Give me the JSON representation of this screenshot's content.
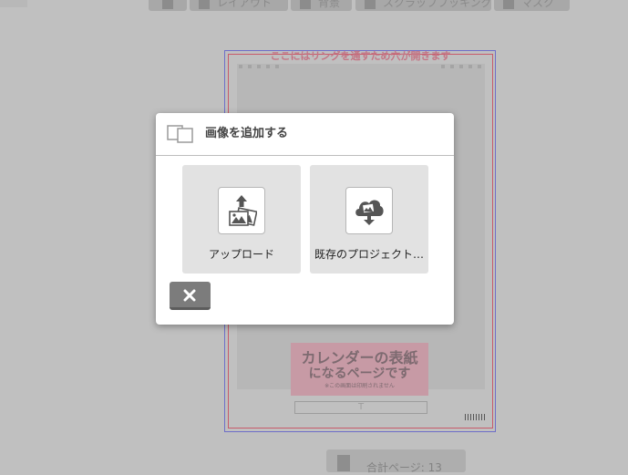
{
  "toolbar": {
    "items": [
      {
        "label": "",
        "icon": "pause-icon"
      },
      {
        "label": "レイアウト",
        "icon": "layout-icon"
      },
      {
        "label": "背景",
        "icon": "background-icon"
      },
      {
        "label": "スクラップブッキング",
        "icon": "scrapbook-icon"
      },
      {
        "label": "マスク",
        "icon": "mask-icon"
      }
    ]
  },
  "page": {
    "ring_notice": "ここにはリングを通すため穴が開きます",
    "cover_line1": "カレンダーの表紙",
    "cover_line2": "になるページです",
    "cover_note": "※この画面は印刷されません",
    "text_placeholder": "T"
  },
  "page_count": {
    "label": "合計ページ:",
    "value": "13"
  },
  "modal": {
    "title": "画像を追加する",
    "upload_label": "アップロード",
    "existing_label": "既存のプロジェクト…",
    "icons": {
      "header": "photos-icon",
      "upload": "upload-photo-icon",
      "existing": "cloud-download-icon",
      "close": "close-icon"
    }
  },
  "colors": {
    "overlay": "#c0c0c0",
    "modal_bg": "#ffffff",
    "option_bg": "#e2e2e2",
    "close_btn": "#7c7c7c",
    "page_border_outer": "#6e6ec8",
    "page_border_inner": "#c85a6a",
    "cover_label_bg": "#c79aa5"
  }
}
